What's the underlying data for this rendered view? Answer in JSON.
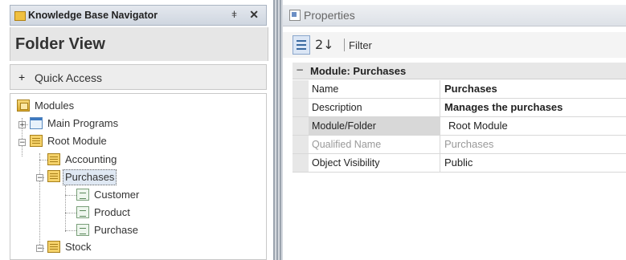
{
  "navigator": {
    "title": "Knowledge Base Navigator",
    "pin_glyph": "ǂ",
    "close_glyph": "✕",
    "folder_view": "Folder View",
    "quick_access": "Quick Access",
    "quick_access_toggle": "+",
    "tree": {
      "modules": "Modules",
      "main_programs": "Main Programs",
      "root_module": "Root Module",
      "accounting": "Accounting",
      "purchases": "Purchases",
      "customer": "Customer",
      "product": "Product",
      "purchase": "Purchase",
      "stock": "Stock"
    },
    "expand_glyph": "+",
    "collapse_glyph": "−"
  },
  "properties": {
    "title": "Properties",
    "toolbar": {
      "sort_alpha_glyph": "2↓",
      "filter_label": "Filter"
    },
    "category": {
      "toggle": "−",
      "label": "Module: Purchases"
    },
    "rows": [
      {
        "name": "Name",
        "value": "Purchases"
      },
      {
        "name": "Description",
        "value": "Manages the purchases"
      },
      {
        "name": "Module/Folder",
        "value": "Root Module"
      },
      {
        "name": "Qualified Name",
        "value": "Purchases"
      },
      {
        "name": "Object Visibility",
        "value": "Public"
      }
    ]
  }
}
